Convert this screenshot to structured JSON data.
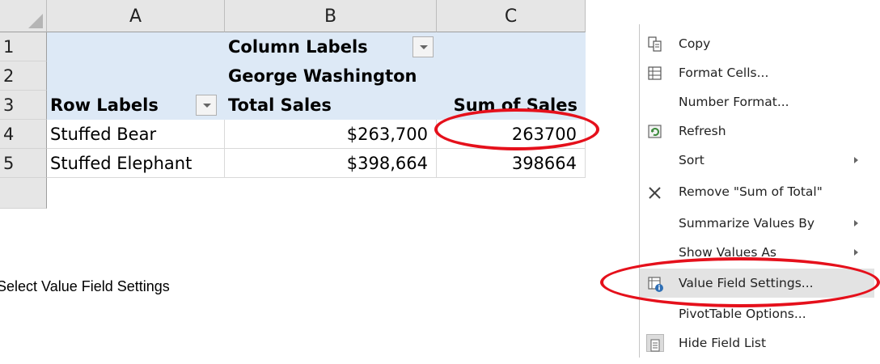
{
  "spreadsheet": {
    "columns": [
      "A",
      "B",
      "C"
    ],
    "rows": [
      "1",
      "2",
      "3",
      "4",
      "5"
    ],
    "pivot": {
      "column_labels": "Column Labels",
      "column_value": "George Washington",
      "row_labels": "Row Labels",
      "total_sales_header": "Total Sales",
      "sum_of_sales_header": "Sum of Sales",
      "records": [
        {
          "label": "Stuffed Bear",
          "total_sales": "$263,700",
          "sum_of_sales": "263700"
        },
        {
          "label": "Stuffed Elephant",
          "total_sales": "$398,664",
          "sum_of_sales": "398664"
        }
      ]
    }
  },
  "caption": "Select Value Field Settings",
  "context_menu": {
    "items": [
      {
        "label": "Copy",
        "icon": "copy-icon"
      },
      {
        "label": "Format Cells...",
        "icon": "format-cells-icon"
      },
      {
        "label": "Number Format...",
        "icon": ""
      },
      {
        "label": "Refresh",
        "icon": "refresh-icon"
      },
      {
        "label": "Sort",
        "icon": "",
        "submenu": true
      },
      {
        "label": "Remove \"Sum of Total\"",
        "icon": "remove-x-icon"
      },
      {
        "label": "Summarize Values By",
        "icon": "",
        "submenu": true
      },
      {
        "label": "Show Values As",
        "icon": "",
        "submenu": true
      },
      {
        "label": "Value Field Settings...",
        "icon": "value-field-settings-icon"
      },
      {
        "label": "PivotTable Options...",
        "icon": ""
      },
      {
        "label": "Hide Field List",
        "icon": "field-list-icon"
      }
    ]
  },
  "colors": {
    "pivot_header_fill": "#dde9f6",
    "highlight_ellipse": "#e5101b"
  }
}
